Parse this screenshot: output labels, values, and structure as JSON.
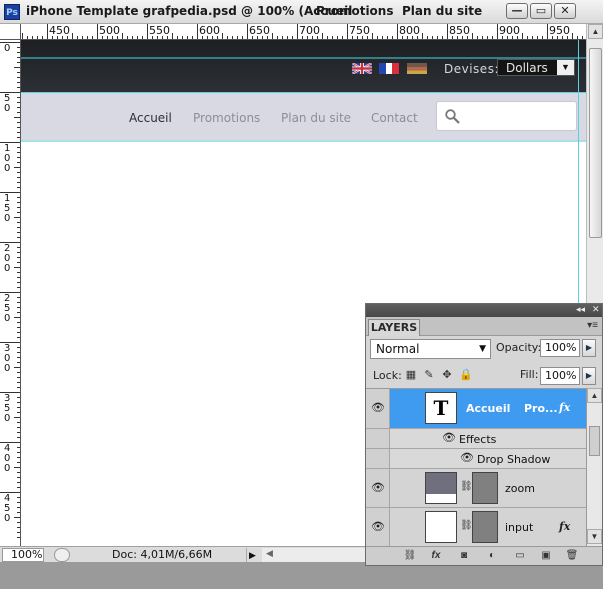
{
  "window": {
    "title": "iPhone Template grafpedia.psd @ 100% (Accueil",
    "title_suffix_items": [
      "Promotions",
      "Plan du site"
    ],
    "buttons": {
      "minimize": "—",
      "restore": "▭",
      "close": "✕"
    }
  },
  "app_icon": "Ps",
  "ruler_top": {
    "labels": [
      "450",
      "500",
      "550",
      "600",
      "650",
      "700",
      "750",
      "800",
      "850",
      "900",
      "950"
    ]
  },
  "ruler_left": {
    "labels": [
      "0",
      "50",
      "100",
      "150",
      "200",
      "250",
      "300",
      "350",
      "400",
      "450"
    ]
  },
  "canvas": {
    "flags": [
      "uk-flag",
      "fr-flag",
      "de-flag"
    ],
    "devises_label": "Devises:",
    "currency_value": "Dollars",
    "nav": [
      "Accueil",
      "Promotions",
      "Plan du site",
      "Contact"
    ],
    "search_icon": "search-icon",
    "colors": {
      "topbar": "#23262b",
      "navbar": "#d9d9e4",
      "guide": "#5ad0e0",
      "nav_active": "#2e2e38",
      "nav_inactive": "#8d8d99"
    }
  },
  "status": {
    "zoom": "100%",
    "doc": "Doc: 4,01M/6,66M"
  },
  "layers_panel": {
    "tab": "LAYERS",
    "blend_mode": "Normal",
    "opacity_label": "Opacity:",
    "opacity_value": "100%",
    "lock_label": "Lock:",
    "fill_label": "Fill:",
    "fill_value": "100%",
    "layers": [
      {
        "name": "Accueil",
        "extra": "Pro...",
        "type": "text",
        "selected": true,
        "fx": "fx"
      },
      {
        "name": "Effects",
        "type": "effects"
      },
      {
        "name": "Drop Shadow",
        "type": "effect-item"
      },
      {
        "name": "zoom",
        "type": "shape"
      },
      {
        "name": "input",
        "type": "shape",
        "fx": "fx"
      }
    ],
    "thumb_letter": "T",
    "selected_color": "#3f9bf0"
  }
}
